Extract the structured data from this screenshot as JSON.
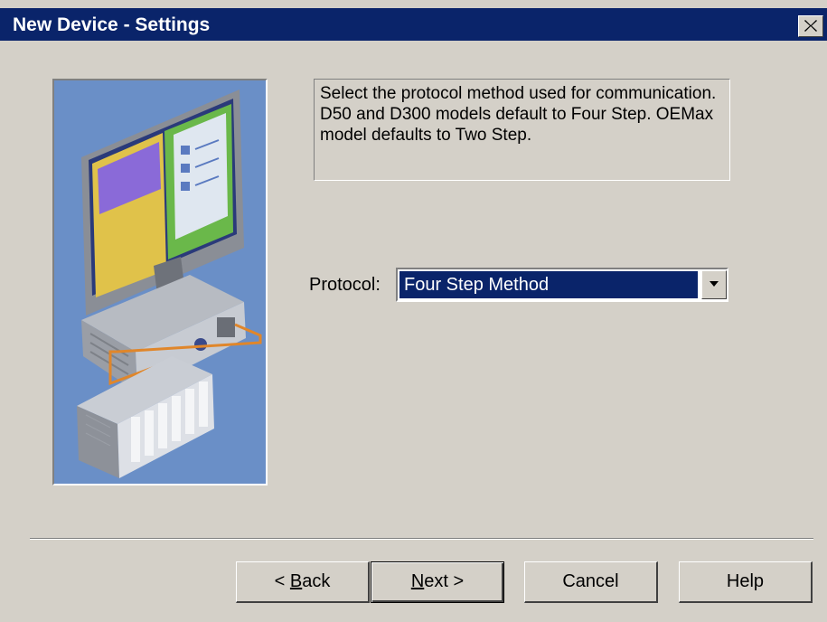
{
  "window": {
    "title": "New Device - Settings",
    "titlebar_color": "#0a246a"
  },
  "description": "Select the protocol method used for communication.  D50 and D300 models default to Four Step.  OEMax model defaults to Two Step.",
  "protocol": {
    "label": "Protocol:",
    "selected": "Four Step Method"
  },
  "buttons": {
    "back": {
      "mnemonic": "B",
      "rest": "ack",
      "prefix": "< "
    },
    "next": {
      "mnemonic": "N",
      "rest": "ext >"
    },
    "cancel": "Cancel",
    "help": "Help"
  },
  "icons": {
    "close": "close-icon",
    "dropdown": "chevron-down-icon"
  }
}
